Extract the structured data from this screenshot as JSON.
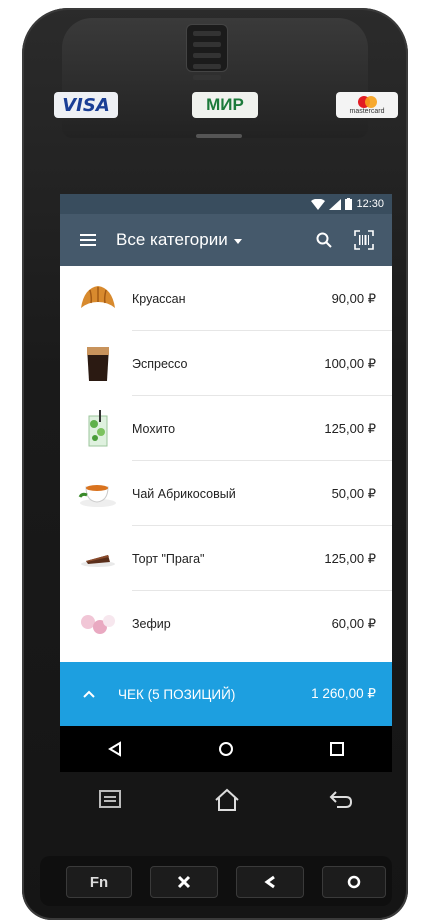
{
  "device": {
    "card_logos": {
      "visa": "VISA",
      "mir": "МИР",
      "mastercard": "mastercard"
    }
  },
  "status_bar": {
    "time": "12:30"
  },
  "app_bar": {
    "title": "Все категории",
    "menu_icon": "hamburger-menu-icon",
    "search_icon": "search-icon",
    "scan_icon": "barcode-scan-icon"
  },
  "products": [
    {
      "name": "Круассан",
      "price": "90,00 ₽",
      "icon": "croissant-icon"
    },
    {
      "name": "Эспрессо",
      "price": "100,00 ₽",
      "icon": "espresso-cup-icon"
    },
    {
      "name": "Мохито",
      "price": "125,00 ₽",
      "icon": "mojito-glass-icon"
    },
    {
      "name": "Чай Абрикосовый",
      "price": "50,00 ₽",
      "icon": "tea-cup-icon"
    },
    {
      "name": "Торт \"Прага\"",
      "price": "125,00 ₽",
      "icon": "cake-slice-icon"
    },
    {
      "name": "Зефир",
      "price": "60,00 ₽",
      "icon": "marshmallow-icon"
    }
  ],
  "check_bar": {
    "label": "ЧЕК (5 ПОЗИЦИЙ)",
    "total": "1 260,00 ₽",
    "color": "#1d9fe0"
  },
  "hardware_keys": {
    "fn": "Fn"
  },
  "colors": {
    "app_bar": "#45596b",
    "status_bar": "#394d5e",
    "accent": "#1d9fe0"
  }
}
